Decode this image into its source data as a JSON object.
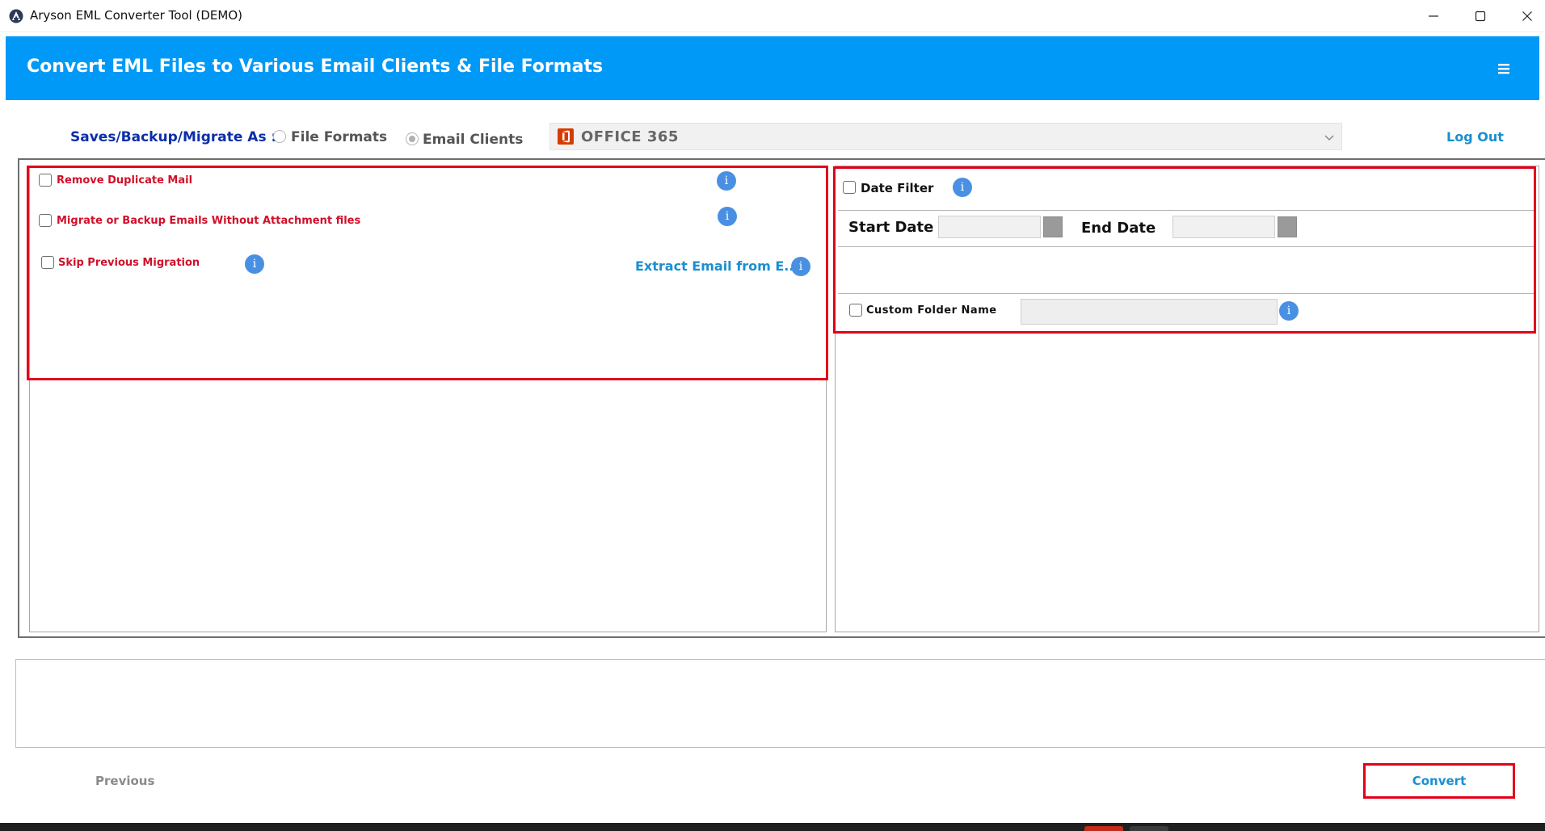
{
  "window": {
    "title": "Aryson EML Converter Tool (DEMO)"
  },
  "banner": {
    "title": "Convert EML Files to Various Email Clients & File Formats"
  },
  "save_bar": {
    "label": "Saves/Backup/Migrate As :",
    "options": [
      {
        "label": "File Formats",
        "selected": false
      },
      {
        "label": "Email Clients",
        "selected": true
      }
    ],
    "selected_client": "OFFICE 365",
    "logout_label": "Log Out"
  },
  "left_options": {
    "items": [
      {
        "label": "Remove Duplicate Mail",
        "checked": false
      },
      {
        "label": "Migrate or Backup Emails Without Attachment files",
        "checked": false
      },
      {
        "label": "Skip Previous Migration",
        "checked": false
      }
    ],
    "extract_link": "Extract Email from E...",
    "info_glyph": "i"
  },
  "right_options": {
    "date_filter_label": "Date Filter",
    "date_filter_checked": false,
    "start_date_label": "Start Date",
    "start_date_value": "",
    "end_date_label": "End Date",
    "end_date_value": "",
    "custom_folder_label": "Custom Folder Name",
    "custom_folder_checked": false,
    "custom_folder_value": ""
  },
  "footer": {
    "previous_label": "Previous",
    "convert_label": "Convert"
  },
  "colors": {
    "banner": "#0099f7",
    "highlight": "#e3001b",
    "option_text": "#d1102a",
    "link": "#1a8fd0",
    "save_label": "#0c2ea8"
  }
}
